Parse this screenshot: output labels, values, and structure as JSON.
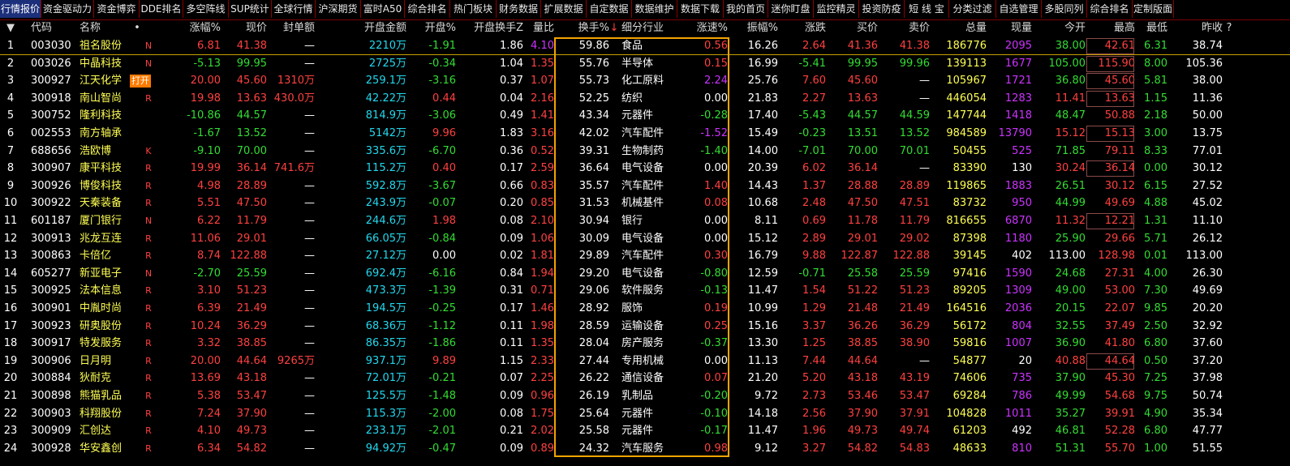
{
  "tabs": [
    "行情报价",
    "资金驱动力",
    "资金博弈",
    "DDE排名",
    "多空阵线",
    "SUP统计",
    "全球行情",
    "沪深期货",
    "富时A50",
    "综合排名",
    "热门板块",
    "财务数据",
    "扩展数据",
    "自定数据",
    "数据维护",
    "数据下载",
    "我的首页",
    "迷你盯盘",
    "监控精灵",
    "投资防疫",
    "短 线 宝",
    "分类过滤",
    "自选管理",
    "多股同列",
    "综合排名",
    "定制版面"
  ],
  "active_tab": 0,
  "columns": [
    "代码",
    "名称",
    "涨幅%",
    "现价",
    "封单额",
    "开盘金额",
    "开盘%",
    "开盘换手Z",
    "量比",
    "换手%",
    "细分行业",
    "涨速%",
    "振幅%",
    "涨跌",
    "买价",
    "卖价",
    "总量",
    "现量",
    "今开",
    "最高",
    "最低",
    "昨收"
  ],
  "header_marks": {
    "sort_arrow": "▼",
    "name_dot": "•",
    "sort_down": "↓",
    "question": "?"
  },
  "rows": [
    [
      "1",
      "003030",
      "祖名股份",
      "N",
      "6.81",
      "41.38",
      "—",
      "2210万",
      "-1.91",
      "1.86",
      "4.10",
      "59.86",
      "食品",
      "0.56",
      "16.26",
      "2.64",
      "41.36",
      "41.38",
      "186776",
      "2095",
      "38.00",
      "42.61",
      "6.31",
      "38.74"
    ],
    [
      "2",
      "003026",
      "中晶科技",
      "N",
      "-5.13",
      "99.95",
      "—",
      "2725万",
      "-0.34",
      "1.04",
      "1.35",
      "55.76",
      "半导体",
      "0.15",
      "16.99",
      "-5.41",
      "99.95",
      "99.96",
      "139113",
      "1677",
      "105.00",
      "115.90",
      "8.00",
      "105.36"
    ],
    [
      "3",
      "300927",
      "江天化学",
      "R",
      "20.00",
      "45.60",
      "1310万",
      "259.1万",
      "-3.16",
      "0.37",
      "1.07",
      "55.73",
      "化工原料",
      "2.24",
      "25.76",
      "7.60",
      "45.60",
      "—",
      "105967",
      "1721",
      "36.80",
      "45.60",
      "5.81",
      "38.00"
    ],
    [
      "4",
      "300918",
      "南山智尚",
      "R",
      "19.98",
      "13.63",
      "430.0万",
      "42.22万",
      "0.44",
      "0.04",
      "2.16",
      "52.25",
      "纺织",
      "0.00",
      "21.83",
      "2.27",
      "13.63",
      "—",
      "446054",
      "1283",
      "11.41",
      "13.63",
      "1.15",
      "11.36"
    ],
    [
      "5",
      "300752",
      "隆利科技",
      "",
      "-10.86",
      "44.57",
      "—",
      "814.9万",
      "-3.06",
      "0.49",
      "1.41",
      "43.34",
      "元器件",
      "-0.28",
      "17.40",
      "-5.43",
      "44.57",
      "44.59",
      "147744",
      "1418",
      "48.47",
      "50.88",
      "2.18",
      "50.00"
    ],
    [
      "6",
      "002553",
      "南方轴承",
      "",
      "-1.67",
      "13.52",
      "—",
      "5142万",
      "9.96",
      "1.83",
      "3.16",
      "42.02",
      "汽车配件",
      "-1.52",
      "15.49",
      "-0.23",
      "13.51",
      "13.52",
      "984589",
      "13790",
      "15.12",
      "15.13",
      "3.00",
      "13.75"
    ],
    [
      "7",
      "688656",
      "浩欧博",
      "K",
      "-9.10",
      "70.00",
      "—",
      "335.6万",
      "-6.70",
      "0.36",
      "0.52",
      "39.31",
      "生物制药",
      "-1.40",
      "14.00",
      "-7.01",
      "70.00",
      "70.01",
      "50455",
      "525",
      "71.85",
      "79.11",
      "8.33",
      "77.01"
    ],
    [
      "8",
      "300907",
      "康平科技",
      "R",
      "19.99",
      "36.14",
      "741.6万",
      "115.2万",
      "0.40",
      "0.17",
      "2.59",
      "36.64",
      "电气设备",
      "0.00",
      "20.39",
      "6.02",
      "36.14",
      "—",
      "83390",
      "130",
      "30.24",
      "36.14",
      "0.00",
      "30.12"
    ],
    [
      "9",
      "300926",
      "博俊科技",
      "R",
      "4.98",
      "28.89",
      "—",
      "592.8万",
      "-3.67",
      "0.66",
      "0.83",
      "35.57",
      "汽车配件",
      "1.40",
      "14.43",
      "1.37",
      "28.88",
      "28.89",
      "119865",
      "1883",
      "26.51",
      "30.12",
      "6.15",
      "27.52"
    ],
    [
      "10",
      "300922",
      "天秦装备",
      "R",
      "5.51",
      "47.50",
      "—",
      "243.9万",
      "-0.07",
      "0.20",
      "0.85",
      "31.53",
      "机械基件",
      "0.08",
      "10.68",
      "2.48",
      "47.50",
      "47.51",
      "83732",
      "950",
      "44.99",
      "49.69",
      "4.88",
      "45.02"
    ],
    [
      "11",
      "601187",
      "厦门银行",
      "N",
      "6.22",
      "11.79",
      "—",
      "244.6万",
      "1.98",
      "0.08",
      "2.10",
      "30.94",
      "银行",
      "0.00",
      "8.11",
      "0.69",
      "11.78",
      "11.79",
      "816655",
      "6870",
      "11.32",
      "12.21",
      "1.31",
      "11.10"
    ],
    [
      "12",
      "300913",
      "兆龙互连",
      "R",
      "11.06",
      "29.01",
      "—",
      "66.05万",
      "-0.84",
      "0.09",
      "1.06",
      "30.09",
      "电气设备",
      "0.00",
      "15.12",
      "2.89",
      "29.01",
      "29.02",
      "87398",
      "1180",
      "25.90",
      "29.66",
      "5.71",
      "26.12"
    ],
    [
      "13",
      "300863",
      "卡倍亿",
      "R",
      "8.74",
      "122.88",
      "—",
      "27.12万",
      "0.00",
      "0.02",
      "1.81",
      "29.89",
      "汽车配件",
      "0.30",
      "16.79",
      "9.88",
      "122.87",
      "122.88",
      "39145",
      "402",
      "113.00",
      "128.98",
      "0.01",
      "113.00"
    ],
    [
      "14",
      "605277",
      "新亚电子",
      "N",
      "-2.70",
      "25.59",
      "—",
      "692.4万",
      "-6.16",
      "0.84",
      "1.94",
      "29.20",
      "电气设备",
      "-0.80",
      "12.59",
      "-0.71",
      "25.58",
      "25.59",
      "97416",
      "1590",
      "24.68",
      "27.31",
      "4.00",
      "26.30"
    ],
    [
      "15",
      "300925",
      "法本信息",
      "R",
      "3.10",
      "51.23",
      "—",
      "473.3万",
      "-1.39",
      "0.31",
      "0.71",
      "29.06",
      "软件服务",
      "-0.13",
      "11.47",
      "1.54",
      "51.22",
      "51.23",
      "89205",
      "1309",
      "49.00",
      "53.00",
      "7.30",
      "49.69"
    ],
    [
      "16",
      "300901",
      "中胤时尚",
      "R",
      "6.39",
      "21.49",
      "—",
      "194.5万",
      "-0.25",
      "0.17",
      "1.46",
      "28.92",
      "服饰",
      "0.19",
      "10.99",
      "1.29",
      "21.48",
      "21.49",
      "164516",
      "2036",
      "20.15",
      "22.07",
      "9.85",
      "20.20"
    ],
    [
      "17",
      "300923",
      "研奥股份",
      "R",
      "10.24",
      "36.29",
      "—",
      "68.36万",
      "-1.12",
      "0.11",
      "1.98",
      "28.59",
      "运输设备",
      "0.25",
      "15.16",
      "3.37",
      "36.26",
      "36.29",
      "56172",
      "804",
      "32.55",
      "37.49",
      "2.50",
      "32.92"
    ],
    [
      "18",
      "300917",
      "特发服务",
      "R",
      "3.32",
      "38.85",
      "—",
      "86.35万",
      "-1.86",
      "0.11",
      "1.35",
      "28.04",
      "房产服务",
      "-0.37",
      "13.30",
      "1.25",
      "38.85",
      "38.90",
      "59816",
      "1007",
      "36.90",
      "41.80",
      "6.80",
      "37.60"
    ],
    [
      "19",
      "300906",
      "日月明",
      "R",
      "20.00",
      "44.64",
      "9265万",
      "937.1万",
      "9.89",
      "1.15",
      "2.33",
      "27.44",
      "专用机械",
      "0.00",
      "11.13",
      "7.44",
      "44.64",
      "—",
      "54877",
      "20",
      "40.88",
      "44.64",
      "0.50",
      "37.20"
    ],
    [
      "20",
      "300884",
      "狄耐克",
      "R",
      "13.69",
      "43.18",
      "—",
      "72.01万",
      "-0.21",
      "0.07",
      "2.25",
      "26.22",
      "通信设备",
      "0.07",
      "21.20",
      "5.20",
      "43.18",
      "43.19",
      "74606",
      "735",
      "37.90",
      "45.30",
      "7.25",
      "37.98"
    ],
    [
      "21",
      "300898",
      "熊猫乳品",
      "R",
      "5.38",
      "53.47",
      "—",
      "125.5万",
      "-1.48",
      "0.09",
      "0.96",
      "26.19",
      "乳制品",
      "-0.20",
      "9.72",
      "2.73",
      "53.46",
      "53.47",
      "69284",
      "786",
      "49.99",
      "54.68",
      "9.75",
      "50.74"
    ],
    [
      "22",
      "300903",
      "科翔股份",
      "R",
      "7.24",
      "37.90",
      "—",
      "115.3万",
      "-2.00",
      "0.08",
      "1.75",
      "25.64",
      "元器件",
      "-0.10",
      "14.18",
      "2.56",
      "37.90",
      "37.91",
      "104828",
      "1011",
      "35.27",
      "39.91",
      "4.90",
      "35.34"
    ],
    [
      "23",
      "300909",
      "汇创达",
      "R",
      "4.10",
      "49.73",
      "—",
      "233.1万",
      "-2.01",
      "0.21",
      "2.02",
      "25.58",
      "元器件",
      "-0.17",
      "11.47",
      "1.96",
      "49.73",
      "49.74",
      "61203",
      "492",
      "46.81",
      "52.28",
      "6.80",
      "47.77"
    ],
    [
      "24",
      "300928",
      "华安鑫创",
      "R",
      "6.34",
      "54.82",
      "—",
      "94.92万",
      "-0.47",
      "0.09",
      "0.89",
      "24.32",
      "汽车服务",
      "0.98",
      "9.12",
      "3.27",
      "54.82",
      "54.83",
      "48633",
      "810",
      "51.31",
      "55.70",
      "1.00",
      "51.55"
    ]
  ],
  "open_badge": "打开",
  "colors": {
    "up": "#ff4040",
    "down": "#33dd33",
    "flat": "#ffffff",
    "volume": "#ffff55",
    "amount": "#22d8ee",
    "highlight_box": "#f2a400",
    "tab_active": "#1c2f7a"
  }
}
